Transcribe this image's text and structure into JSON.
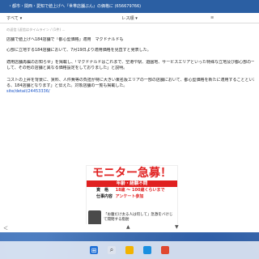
{
  "window": {
    "title": "・都市・関西・愛知で値上げへ『世帯店舗ぶん』の価格に (656679766)",
    "toolbar": {
      "left": "すべて ▾",
      "mid": "レス順 ▾",
      "right": "≡"
    }
  },
  "article": {
    "meta": "の返信 (返信はタイムライン / (1件) ...",
    "p1": "店舗で値上げへ184店舗で「都心型価格」適用　マクドナルドも",
    "p2": "心部に立地する184店舗において、7月19日より適用価格を見直すと発表した。",
    "p3": "適用店舗再編のお知らせ」を掲載し、「マクドナルドはこれまで、空港や駅、遊園地、サービスエリアといった特殊な立地及び都心部の一部の",
    "p4": "して、その他の店舗と異なる価格設定をしておりました」と説明。",
    "p5": "コストの上昇を背景に、賃料、人件費等の負担が特に大きい東名阪エリアの一部の店舗において、都心型価格を新たに適用することといたしま",
    "p6": "る、184店舗となります」と伝えた。対象店舗の一覧も掲載した。",
    "link": "site/detail/24453336/"
  },
  "ad": {
    "headline": "モニター急募！",
    "band": "年齢・経験不問",
    "rows": [
      {
        "k": "資　格",
        "v": "18歳 ～ 100歳くらいまで"
      },
      {
        "k": "仕事内容",
        "v": "アンケート参加"
      }
    ],
    "caption": "「お腹だけ太る人は何して」急激をバけじて開閉する脂肪"
  },
  "nav": {
    "left": "＜",
    "mid": "▲",
    "right": "▼"
  },
  "colors": {
    "titlebar": "#2b5fa3",
    "ad_red": "#e02020",
    "link": "#1a55c8"
  }
}
